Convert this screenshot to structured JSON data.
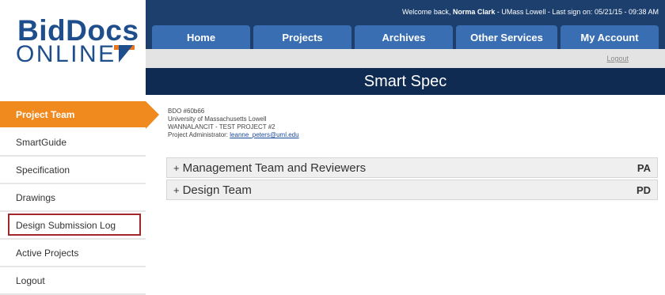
{
  "logo": {
    "line1": "BidDocs",
    "line2": "ONLINE"
  },
  "header": {
    "welcome_prefix": "Welcome back,",
    "user_name": "Norma Clark",
    "welcome_suffix": "- UMass Lowell - Last sign on: 05/21/15 - 09:38 AM"
  },
  "nav": {
    "tabs": [
      {
        "label": "Home"
      },
      {
        "label": "Projects"
      },
      {
        "label": "Archives"
      },
      {
        "label": "Other Services"
      },
      {
        "label": "My Account"
      }
    ],
    "logout_label": "Logout"
  },
  "page": {
    "title": "Smart Spec"
  },
  "sidebar": {
    "items": [
      {
        "label": "Project Team"
      },
      {
        "label": "SmartGuide"
      },
      {
        "label": "Specification"
      },
      {
        "label": "Drawings"
      },
      {
        "label": "Design Submission Log"
      },
      {
        "label": "Active Projects"
      },
      {
        "label": "Logout"
      }
    ]
  },
  "project": {
    "id": "BDO #60b66",
    "org": "University of Massachusetts Lowell",
    "name": "WANNALANCIT - TEST PROJECT #2",
    "admin_label": "Project Administrator:",
    "admin_email": "leanne_peters@uml.edu"
  },
  "sections": [
    {
      "expander": "+",
      "title": "Management Team and Reviewers",
      "code": "PA"
    },
    {
      "expander": "+",
      "title": "Design Team",
      "code": "PD"
    }
  ],
  "colors": {
    "brand_blue": "#1f4e8c",
    "header_navy": "#1c3f6e",
    "tab_blue": "#3a6eb2",
    "title_bar": "#0f2b52",
    "active_orange": "#f0891e",
    "highlight_red": "#a3262a"
  }
}
